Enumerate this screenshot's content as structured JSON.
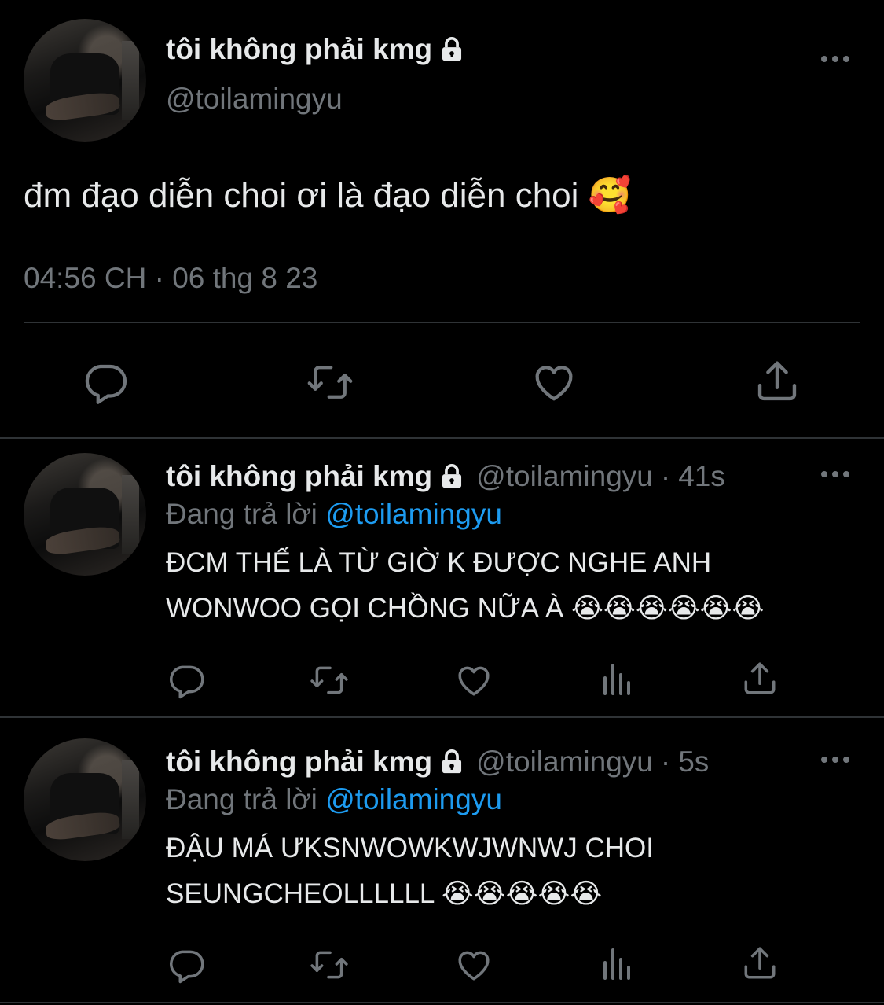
{
  "main_tweet": {
    "display_name": "tôi không phải kmg",
    "handle": "@toilamingyu",
    "text": "đm đạo diễn choi ơi là đạo diễn choi",
    "text_emoji": "🥰",
    "timestamp": "04:56 CH · 06 thg 8 23"
  },
  "replies": [
    {
      "display_name": "tôi không phải kmg",
      "handle": "@toilamingyu",
      "time": "41s",
      "replying_label": "Đang trả lời",
      "replying_to": "@toilamingyu",
      "line1": "ĐCM THẾ LÀ TỪ GIỜ K ĐƯỢC NGHE ANH",
      "line2": "WONWOO GỌI CHỒNG NỮA À",
      "emojis": "😭😭😭😭😭😭"
    },
    {
      "display_name": "tôi không phải kmg",
      "handle": "@toilamingyu",
      "time": "5s",
      "replying_label": "Đang trả lời",
      "replying_to": "@toilamingyu",
      "line1": "ĐẬU MÁ ƯKSNWOWKWJWNWJ CHOI",
      "line2": "SEUNGCHEOLLLLLL",
      "emojis": "😭😭😭😭😭"
    }
  ],
  "separator_dot": "·",
  "colors": {
    "accent": "#1d9bf0",
    "muted": "#71767b",
    "text": "#e7e9ea",
    "background": "#000000"
  },
  "icons": [
    "lock-icon",
    "more-icon",
    "reply-icon",
    "retweet-icon",
    "like-icon",
    "views-icon",
    "share-icon"
  ]
}
